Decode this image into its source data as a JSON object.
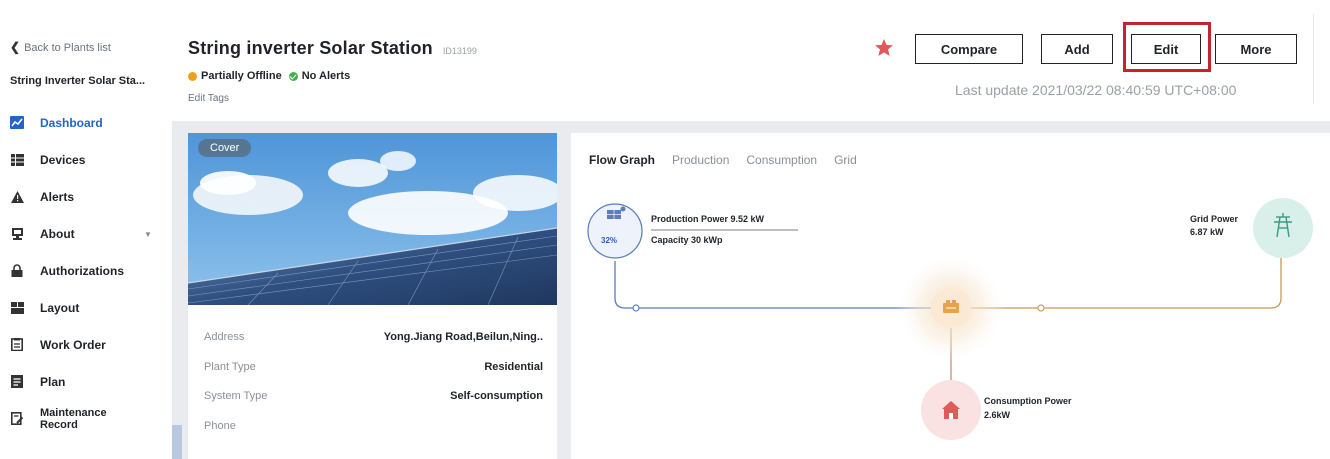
{
  "sidebar": {
    "back_label": "Back to Plants list",
    "plant_name_short": "String Inverter Solar Sta...",
    "items": [
      {
        "label": "Dashboard",
        "icon": "dashboard-icon",
        "active": true
      },
      {
        "label": "Devices",
        "icon": "devices-icon"
      },
      {
        "label": "Alerts",
        "icon": "alert-icon"
      },
      {
        "label": "About",
        "icon": "about-icon",
        "has_caret": true
      },
      {
        "label": "Authorizations",
        "icon": "lock-icon"
      },
      {
        "label": "Layout",
        "icon": "layout-icon"
      },
      {
        "label": "Work Order",
        "icon": "work-order-icon"
      },
      {
        "label": "Plan",
        "icon": "plan-icon"
      },
      {
        "label": "Maintenance Record",
        "icon": "maintenance-icon"
      }
    ]
  },
  "header": {
    "title": "String inverter Solar Station",
    "plant_id": "ID13199",
    "status_partial": "Partially Offline",
    "status_alerts": "No Alerts",
    "edit_tags": "Edit Tags",
    "buttons": {
      "compare": "Compare",
      "add": "Add",
      "edit": "Edit",
      "more": "More"
    },
    "last_update": "Last update 2021/03/22 08:40:59 UTC+08:00"
  },
  "info_card": {
    "cover_label": "Cover",
    "rows": [
      {
        "key": "Address",
        "value": "Yong.Jiang Road,Beilun,Ning.."
      },
      {
        "key": "Plant Type",
        "value": "Residential"
      },
      {
        "key": "System Type",
        "value": "Self-consumption"
      },
      {
        "key": "Phone",
        "value": ""
      }
    ]
  },
  "flow": {
    "tabs": [
      "Flow Graph",
      "Production",
      "Consumption",
      "Grid"
    ],
    "active_tab": "Flow Graph",
    "production_percent": "32%",
    "production_power": "Production Power 9.52 kW",
    "capacity": "Capacity 30 kWp",
    "grid_power_label": "Grid Power",
    "grid_power_value": "6.87 kW",
    "consumption_label": "Consumption Power",
    "consumption_value": "2.6kW"
  },
  "colors": {
    "accent": "#2463c7",
    "highlight": "#c8232c",
    "production_line": "#5b7dbd",
    "grid_line": "#6fb8a8",
    "battery_orange": "#e8a24a",
    "consumption_red": "#e05a5a"
  }
}
